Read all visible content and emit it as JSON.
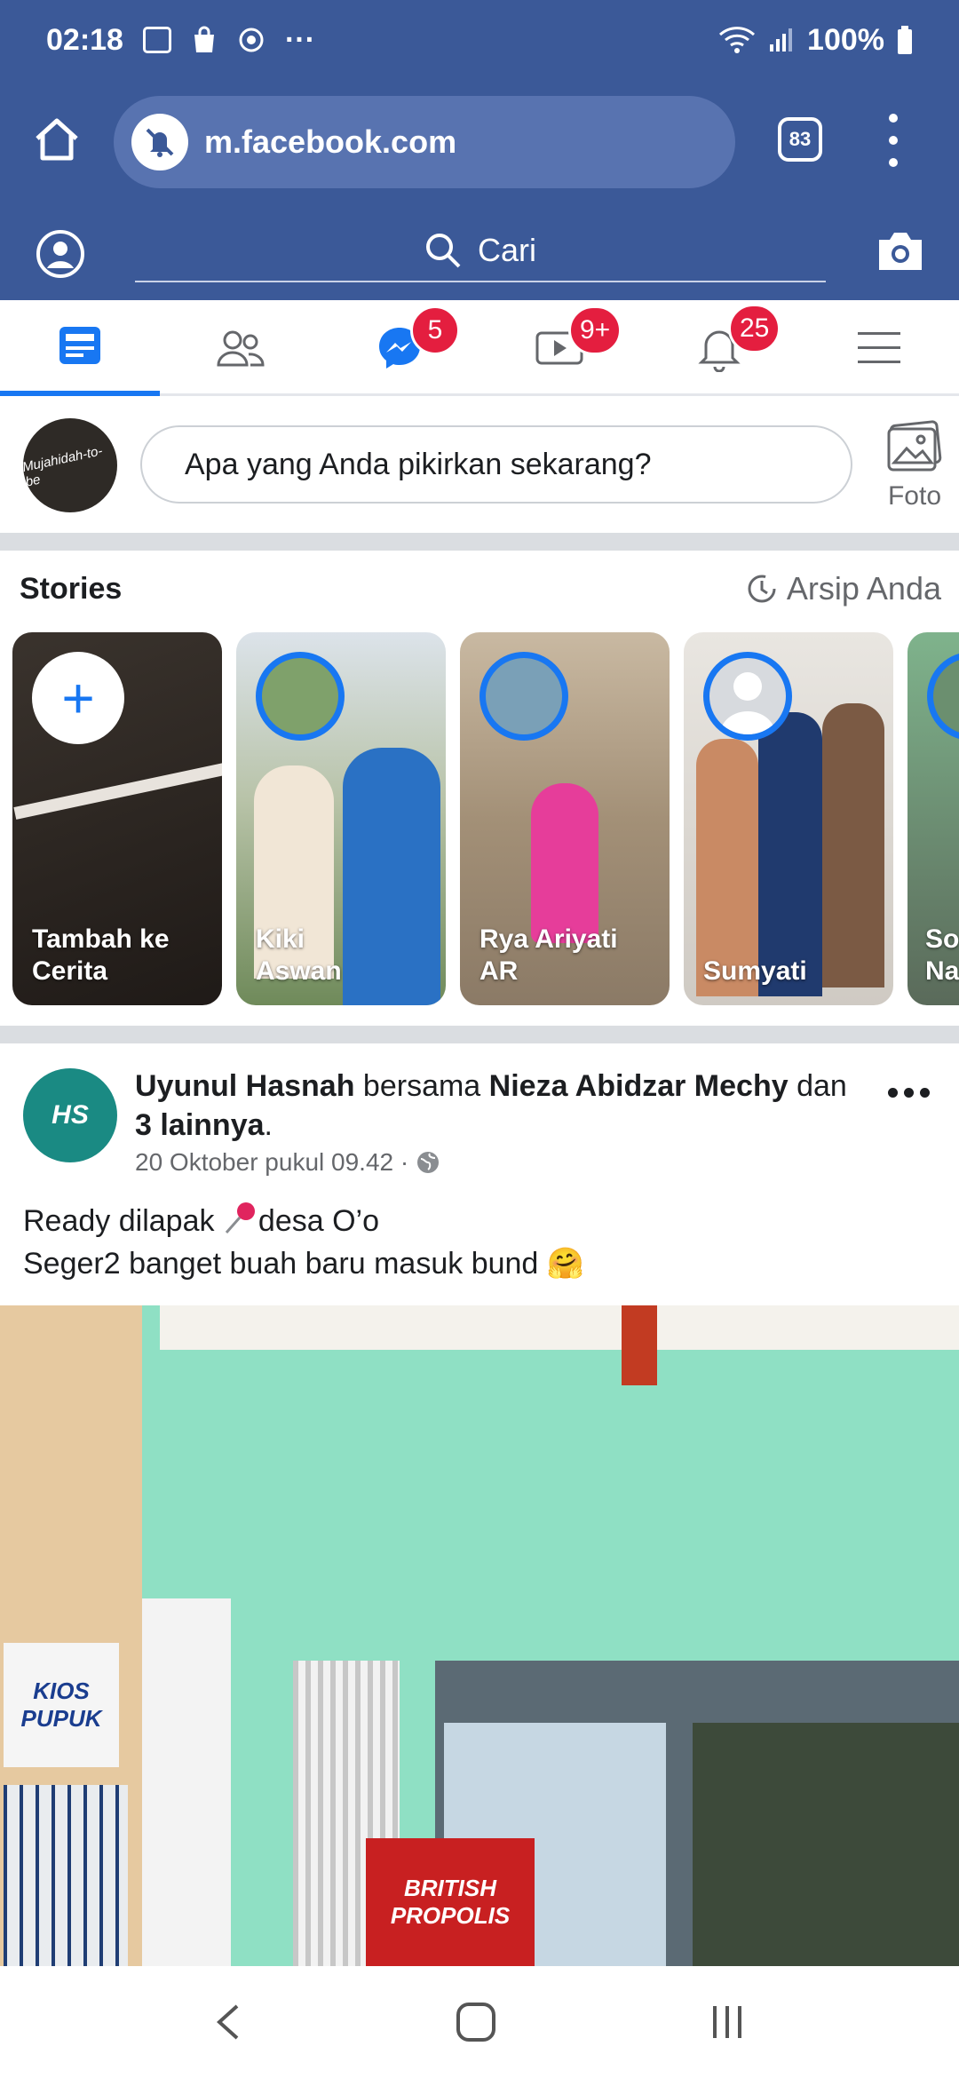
{
  "status_bar": {
    "time": "02:18",
    "battery": "100%"
  },
  "browser": {
    "url": "m.facebook.com",
    "tab_count": "83"
  },
  "search": {
    "placeholder": "Cari"
  },
  "nav": {
    "messenger_badge": "5",
    "watch_badge": "9+",
    "notifications_badge": "25"
  },
  "composer": {
    "avatar_text": "Mujahidah-to-be",
    "prompt": "Apa yang Anda pikirkan sekarang?",
    "photo_label": "Foto"
  },
  "stories": {
    "title": "Stories",
    "archive_label": "Arsip Anda",
    "items": [
      {
        "name_line1": "Tambah ke",
        "name_line2": "Cerita"
      },
      {
        "name_line1": "Kiki",
        "name_line2": "Aswan"
      },
      {
        "name_line1": "Rya Ariyati",
        "name_line2": "AR"
      },
      {
        "name_line1": "Sumyati",
        "name_line2": ""
      },
      {
        "name_line1": "So",
        "name_line2": "Na"
      }
    ]
  },
  "post": {
    "avatar_text": "HS",
    "author": "Uyunul Hasnah",
    "with_word": " bersama ",
    "tagged": "Nieza Abidzar Mechy",
    "and_word": " dan ",
    "others": "3 lainnya",
    "period": ".",
    "timestamp": "20 Oktober pukul 09.42 ·",
    "text_line1_a": "Ready dilapak ",
    "text_line1_b": "desa O’o",
    "text_line2": "Seger2 banget buah baru masuk bund 🤗",
    "photo_sign1": "KIOS PUPUK",
    "photo_sign2": "BRITISH PROPOLIS"
  },
  "colors": {
    "brand": "#3b5998",
    "accent": "#1877f2",
    "badge": "#e41e3f"
  }
}
